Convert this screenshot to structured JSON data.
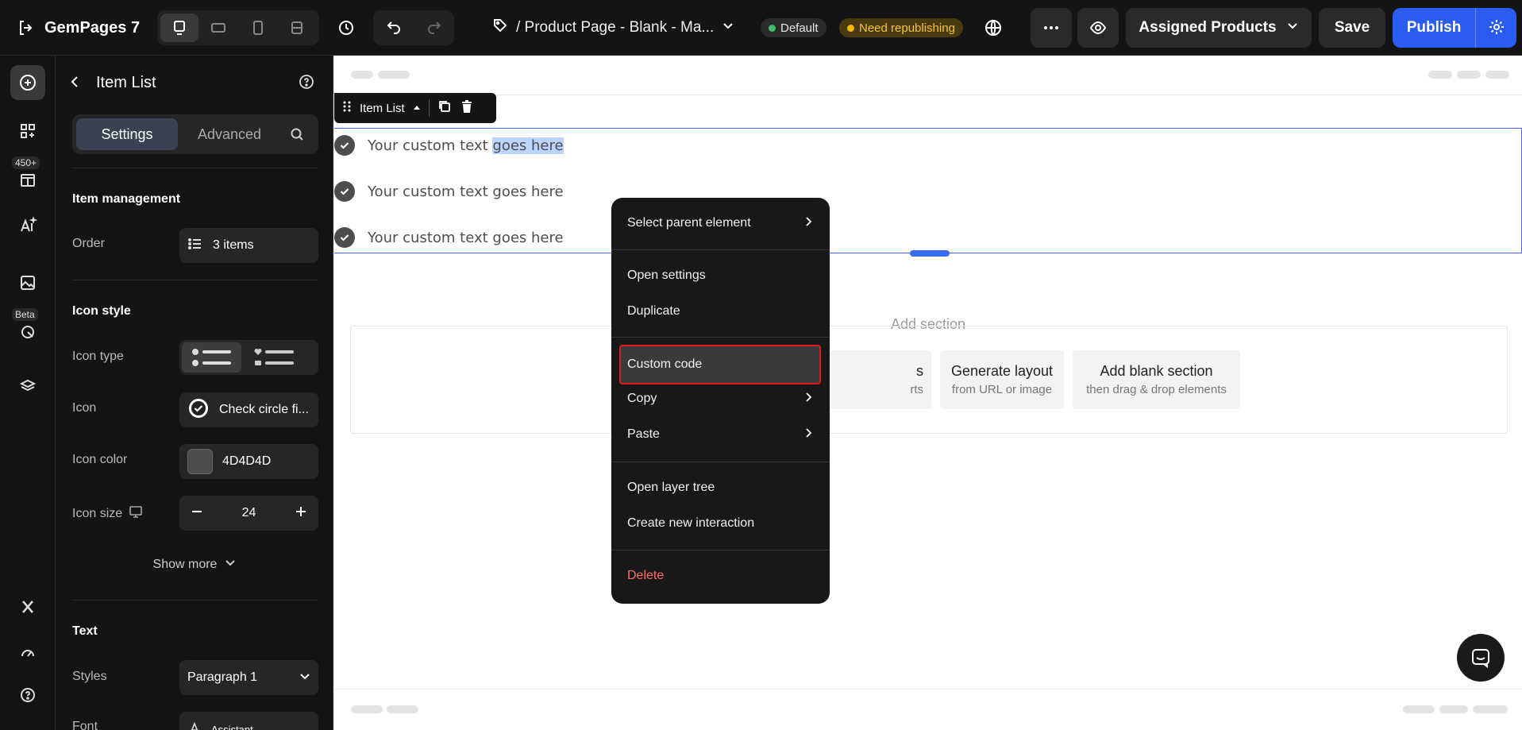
{
  "app": {
    "name": "GemPages 7"
  },
  "topbar": {
    "page_title": "/ Product Page - Blank - Ma...",
    "status_default": "Default",
    "status_republish": "Need republishing",
    "assigned_label": "Assigned Products",
    "save_label": "Save",
    "publish_label": "Publish"
  },
  "rail": {
    "badge_count": "450+",
    "beta_label": "Beta"
  },
  "panel": {
    "title": "Item List",
    "tabs": {
      "settings": "Settings",
      "advanced": "Advanced"
    },
    "item_management": {
      "heading": "Item management",
      "order_label": "Order",
      "order_value": "3 items"
    },
    "icon_style": {
      "heading": "Icon style",
      "type_label": "Icon type",
      "icon_label": "Icon",
      "icon_value": "Check circle fi...",
      "color_label": "Icon color",
      "color_value": "4D4D4D",
      "size_label": "Icon size",
      "size_value": "24",
      "show_more": "Show more"
    },
    "text": {
      "heading": "Text",
      "styles_label": "Styles",
      "styles_value": "Paragraph 1",
      "font_label": "Font",
      "font_value": "Assistant"
    }
  },
  "canvas": {
    "item_list_tag": "Item List",
    "items": [
      {
        "text_a": "Your custom text ",
        "text_b": "goes here"
      },
      {
        "text_a": "Your custom text goes here",
        "text_b": ""
      },
      {
        "text_a": "Your custom text goes here",
        "text_b": ""
      }
    ],
    "add_section": "Add section",
    "cards": [
      {
        "title": "s",
        "sub": "rts"
      },
      {
        "title": "Generate layout",
        "sub": "from URL or image"
      },
      {
        "title": "Add blank section",
        "sub": "then drag & drop elements"
      }
    ]
  },
  "context_menu": {
    "select_parent": "Select parent element",
    "open_settings": "Open settings",
    "duplicate": "Duplicate",
    "custom_code": "Custom code",
    "copy": "Copy",
    "paste": "Paste",
    "open_layer_tree": "Open layer tree",
    "create_interaction": "Create new interaction",
    "delete": "Delete"
  },
  "colors": {
    "accent": "#2b5cf2",
    "icon_color": "#4D4D4D",
    "danger": "#ff6b6b",
    "warning": "#f5c33b"
  }
}
